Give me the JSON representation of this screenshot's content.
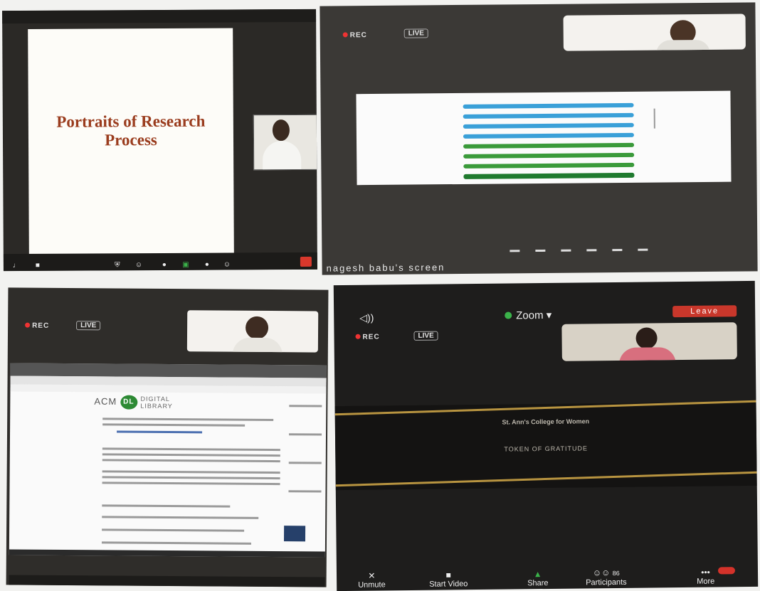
{
  "panel1": {
    "slide_title": "Portraits of Research Process",
    "toolbar_icons": [
      "mic-icon",
      "video-icon",
      "security-icon",
      "participants-icon",
      "chat-icon",
      "share-icon",
      "record-icon",
      "reactions-icon"
    ]
  },
  "panel2": {
    "rec": "REC",
    "live": "LIVE",
    "share_label": "nagesh babu's screen"
  },
  "panel3": {
    "rec": "REC",
    "live": "LIVE",
    "acm_logo_prefix": "ACM",
    "acm_logo_badge": "DL",
    "acm_logo_line1": "DIGITAL",
    "acm_logo_line2": "LIBRARY"
  },
  "panel4": {
    "zoom_label": "Zoom ▾",
    "leave_label": "Leave",
    "rec": "REC",
    "live": "LIVE",
    "college": "St. Ann's College for Women",
    "token": "TOKEN OF GRATITUDE",
    "unmute": "Unmute",
    "start_video": "Start Video",
    "share": "Share",
    "participants": "Participants",
    "participants_count": "86",
    "more": "More"
  },
  "colors": {
    "end_red": "#d8382c",
    "bar_blue": "#3aa0d8",
    "bar_green": "#3a9a3a",
    "acm_green": "#2d8a34",
    "gold": "#b89440"
  }
}
